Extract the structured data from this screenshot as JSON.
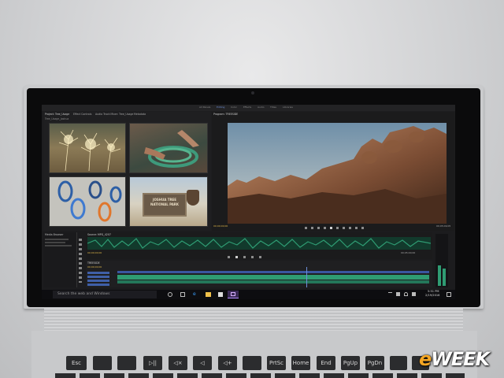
{
  "premiere": {
    "workspace_tabs": [
      "All Panels",
      "Editing",
      "Color",
      "Effects",
      "Audio",
      "Titles",
      "Libraries"
    ],
    "project_panel": {
      "tabs": [
        "Project: Tree_Usage",
        "Effect Controls",
        "Audio Track Mixer: Tree_Usage",
        "Metadata"
      ],
      "path": "Tree_Usage_Joshua"
    },
    "program_monitor": {
      "title": "Program: TREESIDE",
      "timecode_left": "00;00;00;00",
      "timecode_right": "00;05;09;05"
    },
    "source_monitor": {
      "title": "Source: MPG_4207",
      "timecode": "00;00;00;00",
      "timecode_right": "00;05;00;00"
    },
    "media_browser": {
      "title": "Media Browser"
    },
    "timeline": {
      "title": "TREESIDE",
      "timecode": "00;00;00;00"
    }
  },
  "sign_text": {
    "line1": "JOSHUA TREE",
    "line2": "NATIONAL PARK"
  },
  "taskbar": {
    "search_placeholder": "Search the web and Windows",
    "time": "5:51 PM",
    "date": "2/19/2016"
  },
  "keyboard": {
    "keys": [
      "Esc",
      "",
      "",
      "▷||",
      "◁×",
      "◁ ",
      "◁+",
      "",
      "",
      "PrtSc",
      "Home",
      "End",
      "PgUp",
      "PgDn",
      "",
      ""
    ]
  },
  "watermark": {
    "text_e": "e",
    "text_rest": "WEEK"
  },
  "colors": {
    "audio_green": "#2f9c73",
    "audio_waveform": "#1c5e46",
    "accent_blue": "#6d8fd9",
    "brand_orange": "#f5a623"
  }
}
